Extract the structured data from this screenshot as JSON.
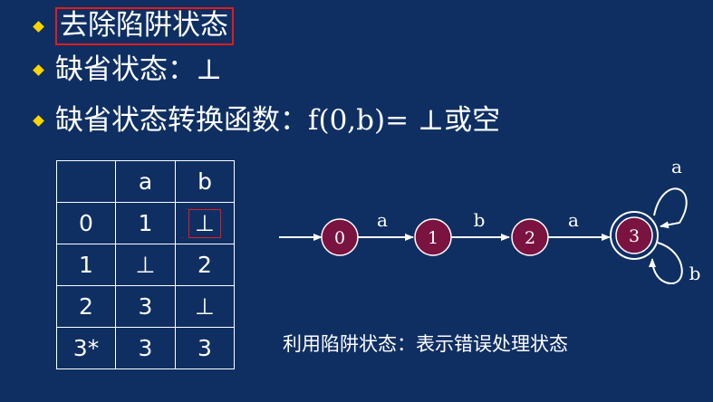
{
  "bullets": [
    {
      "text": "去除陷阱状态"
    },
    {
      "text": "缺省状态：⊥"
    },
    {
      "text": "缺省状态转换函数：f(0,b)= ⊥或空"
    }
  ],
  "table": {
    "header": [
      "",
      "a",
      "b"
    ],
    "rows": [
      [
        "0",
        "1",
        "⊥"
      ],
      [
        "1",
        "⊥",
        "2"
      ],
      [
        "2",
        "3",
        "⊥"
      ],
      [
        "3*",
        "3",
        "3"
      ]
    ]
  },
  "diagram": {
    "states": [
      "0",
      "1",
      "2",
      "3"
    ],
    "edges": [
      "a",
      "b",
      "a"
    ],
    "self_loops": [
      "a",
      "b"
    ]
  },
  "caption": "利用陷阱状态：表示错误处理状态",
  "colors": {
    "background": "#0f2f63",
    "bullet": "#ffd400",
    "state_fill": "#7b1340",
    "highlight": "#e21b1b",
    "text": "#ffffff"
  }
}
